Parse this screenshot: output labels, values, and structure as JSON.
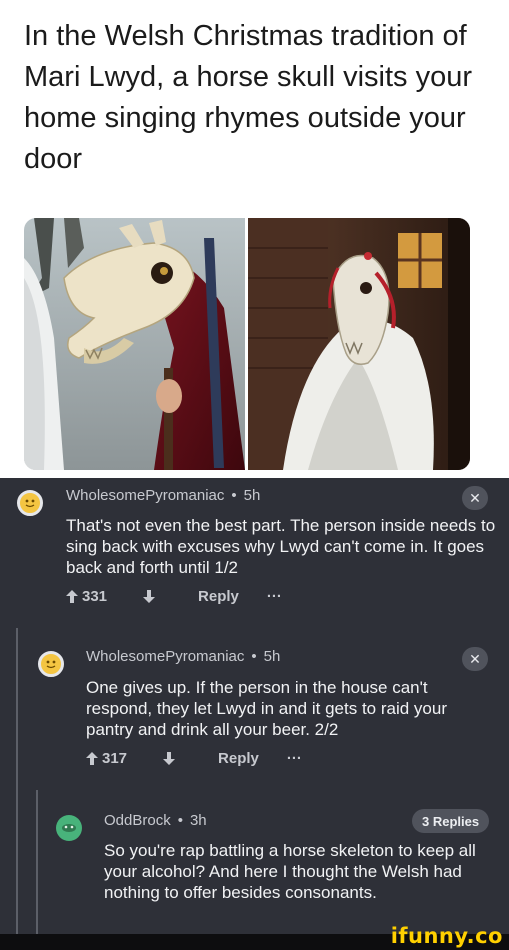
{
  "headline": "In the Welsh Christmas tradition of Mari Lwyd, a horse skull visits your home singing rhymes outside your door",
  "comments": [
    {
      "username": "WholesomePyromaniac",
      "age": "5h",
      "text": "That's not even the best part. The person inside needs to sing back with excuses why Lwyd can't come in. It goes back and forth until 1/2",
      "upvotes": "331",
      "reply_label": "Reply",
      "more": "···",
      "close": "✕"
    },
    {
      "username": "WholesomePyromaniac",
      "age": "5h",
      "text": "One gives up. If the person in the house can't respond, they let Lwyd in and it gets to raid your pantry and drink all your beer. 2/2",
      "upvotes": "317",
      "reply_label": "Reply",
      "more": "···",
      "close": "✕"
    },
    {
      "username": "OddBrock",
      "age": "3h",
      "text": "So you're rap battling a horse skeleton to keep all your alcohol? And here I thought the Welsh had nothing to offer besides consonants.",
      "replies": "3 Replies"
    }
  ],
  "separator": "•",
  "watermark": "ifunny.co",
  "icons": {
    "upvote": "upvote-arrow-icon",
    "downvote": "downvote-arrow-icon",
    "close": "close-icon",
    "avatar": "avatar-icon"
  },
  "colors": {
    "comment_bg": "#2e3038",
    "accent_yellow": "#ffd000",
    "avatar_green": "#48b37b",
    "avatar_yellow": "#f4c542"
  }
}
